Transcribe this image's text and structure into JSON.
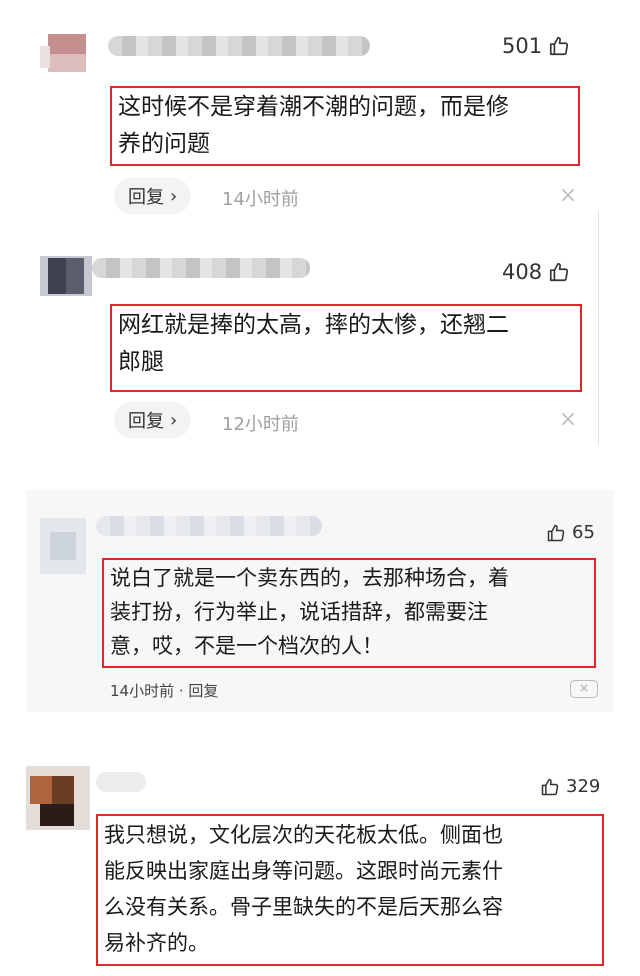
{
  "comments": [
    {
      "likes": "501",
      "text_lines": [
        "这时候不是穿着潮不潮的问题，而是修",
        "养的问题"
      ],
      "reply_label": "回复",
      "time": "14小时前"
    },
    {
      "likes": "408",
      "text_lines": [
        "网红就是捧的太高，摔的太惨，还翘二",
        "郎腿"
      ],
      "reply_label": "回复",
      "time": "12小时前"
    },
    {
      "likes": "65",
      "text_lines": [
        "说白了就是一个卖东西的，去那种场合，着",
        "装打扮，行为举止，说话措辞，都需要注",
        "意，哎，不是一个档次的人！"
      ],
      "meta": "14小时前 · 回复"
    },
    {
      "likes": "329",
      "text_lines": [
        "我只想说，文化层次的天花板太低。侧面也",
        "能反映出家庭出身等问题。这跟时尚元素什",
        "么没有关系。骨子里缺失的不是后天那么容",
        "易补齐的。"
      ]
    }
  ],
  "colors": {
    "highlight_border": "#e02828",
    "muted_text": "#a0a0a0"
  }
}
